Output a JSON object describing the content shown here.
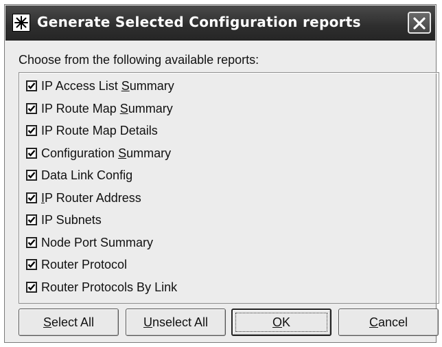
{
  "window": {
    "title": "Generate Selected Configuration reports",
    "icon": "star-burst-icon",
    "close_icon": "close-x-icon"
  },
  "prompt": "Choose from the following available reports:",
  "reports": [
    {
      "before": "IP Access List ",
      "mnemonic": "S",
      "after": "ummary",
      "checked": true
    },
    {
      "before": "IP Route Map ",
      "mnemonic": "S",
      "after": "ummary",
      "checked": true
    },
    {
      "before": "IP Route Map Details",
      "mnemonic": "",
      "after": "",
      "checked": true
    },
    {
      "before": "Configuration ",
      "mnemonic": "S",
      "after": "ummary",
      "checked": true
    },
    {
      "before": "Data Link Config",
      "mnemonic": "",
      "after": "",
      "checked": true
    },
    {
      "before": "",
      "mnemonic": "I",
      "after": "P Router Address",
      "checked": true
    },
    {
      "before": "IP Subnets",
      "mnemonic": "",
      "after": "",
      "checked": true
    },
    {
      "before": "Node Port Summary",
      "mnemonic": "",
      "after": "",
      "checked": true
    },
    {
      "before": "Router Protocol",
      "mnemonic": "",
      "after": "",
      "checked": true
    },
    {
      "before": "Router Protocols By Link",
      "mnemonic": "",
      "after": "",
      "checked": true
    }
  ],
  "buttons": {
    "select_all": {
      "mnemonic": "S",
      "rest": "elect All"
    },
    "unselect_all": {
      "mnemonic": "U",
      "rest": "nselect All"
    },
    "ok": {
      "mnemonic": "O",
      "rest": "K"
    },
    "cancel": {
      "mnemonic": "C",
      "rest": "ancel"
    }
  }
}
